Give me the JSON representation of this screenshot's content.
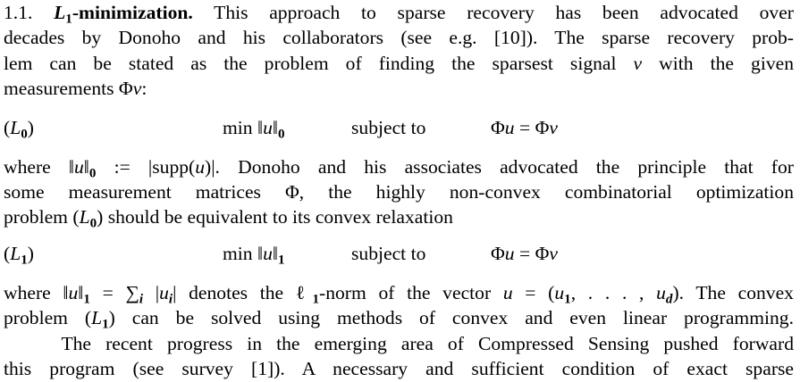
{
  "lines": [
    [
      {
        "t": "1.1. ",
        "s": "n"
      },
      {
        "t": "L",
        "s": "bi"
      },
      {
        "t": "1",
        "s": "bsub"
      },
      {
        "t": "-minimization.",
        "s": "b"
      },
      {
        "t": " This approach to sparse recovery has been advocated over",
        "s": "n"
      }
    ],
    [
      {
        "t": "decades by Donoho and his collaborators (see e.g. [10]). The sparse recovery prob-",
        "s": "n"
      }
    ],
    [
      {
        "t": "lem can be stated as the problem of finding the sparsest signal ",
        "s": "n"
      },
      {
        "t": "v",
        "s": "i"
      },
      {
        "t": " with the given",
        "s": "n"
      }
    ],
    [
      {
        "t": "measurements Φ",
        "s": "n"
      },
      {
        "t": "v",
        "s": "i"
      },
      {
        "t": ":",
        "s": "n"
      }
    ],
    [
      {
        "t": "where ‖",
        "s": "n"
      },
      {
        "t": "u",
        "s": "i"
      },
      {
        "t": "‖",
        "s": "n"
      },
      {
        "t": "0",
        "s": "sub"
      },
      {
        "t": " := |supp(",
        "s": "n"
      },
      {
        "t": "u",
        "s": "i"
      },
      {
        "t": ")|. Donoho and his associates advocated the principle that for",
        "s": "n"
      }
    ],
    [
      {
        "t": "some measurement matrices Φ, the highly non-convex combinatorial optimization",
        "s": "n"
      }
    ],
    [
      {
        "t": "problem (",
        "s": "n"
      },
      {
        "t": "L",
        "s": "i"
      },
      {
        "t": "0",
        "s": "sub"
      },
      {
        "t": ") should be equivalent to its convex relaxation",
        "s": "n"
      }
    ],
    [
      {
        "t": "where ‖",
        "s": "n"
      },
      {
        "t": "u",
        "s": "i"
      },
      {
        "t": "‖",
        "s": "n"
      },
      {
        "t": "1",
        "s": "sub"
      },
      {
        "t": " = ∑",
        "s": "n"
      },
      {
        "t": "i",
        "s": "isub"
      },
      {
        "t": " |",
        "s": "n"
      },
      {
        "t": "u",
        "s": "i"
      },
      {
        "t": "i",
        "s": "isub"
      },
      {
        "t": "| denotes the ℓ",
        "s": "n"
      },
      {
        "t": "1",
        "s": "sub"
      },
      {
        "t": "-norm of the vector ",
        "s": "n"
      },
      {
        "t": "u",
        "s": "i"
      },
      {
        "t": " = (",
        "s": "n"
      },
      {
        "t": "u",
        "s": "i"
      },
      {
        "t": "1",
        "s": "sub"
      },
      {
        "t": ", . . . , ",
        "s": "n"
      },
      {
        "t": "u",
        "s": "i"
      },
      {
        "t": "d",
        "s": "isub"
      },
      {
        "t": "). The convex",
        "s": "n"
      }
    ],
    [
      {
        "t": "problem (",
        "s": "n"
      },
      {
        "t": "L",
        "s": "i"
      },
      {
        "t": "1",
        "s": "sub"
      },
      {
        "t": ") can be solved using methods of convex and even linear programming.",
        "s": "n"
      }
    ],
    [
      {
        "t": "    The recent progress in the emerging area of Compressed Sensing pushed forward",
        "s": "n"
      }
    ],
    [
      {
        "t": "this program (see survey [1]). A necessary and sufficient condition of exact sparse",
        "s": "n"
      }
    ]
  ],
  "equations": [
    {
      "label": [
        {
          "t": "(",
          "s": "n"
        },
        {
          "t": "L",
          "s": "i"
        },
        {
          "t": "0",
          "s": "sub"
        },
        {
          "t": ")",
          "s": "n"
        }
      ],
      "objective": [
        {
          "t": "min ‖",
          "s": "n"
        },
        {
          "t": "u",
          "s": "i"
        },
        {
          "t": "‖",
          "s": "n"
        },
        {
          "t": "0",
          "s": "sub"
        }
      ],
      "subject": [
        {
          "t": "subject to",
          "s": "n"
        }
      ],
      "constraint": [
        {
          "t": "Φ",
          "s": "n"
        },
        {
          "t": "u",
          "s": "i"
        },
        {
          "t": " = Φ",
          "s": "n"
        },
        {
          "t": "v",
          "s": "i"
        }
      ]
    },
    {
      "label": [
        {
          "t": "(",
          "s": "n"
        },
        {
          "t": "L",
          "s": "i"
        },
        {
          "t": "1",
          "s": "sub"
        },
        {
          "t": ")",
          "s": "n"
        }
      ],
      "objective": [
        {
          "t": "min ‖",
          "s": "n"
        },
        {
          "t": "u",
          "s": "i"
        },
        {
          "t": "‖",
          "s": "n"
        },
        {
          "t": "1",
          "s": "sub"
        }
      ],
      "subject": [
        {
          "t": "subject to",
          "s": "n"
        }
      ],
      "constraint": [
        {
          "t": "Φ",
          "s": "n"
        },
        {
          "t": "u",
          "s": "i"
        },
        {
          "t": " = Φ",
          "s": "n"
        },
        {
          "t": "v",
          "s": "i"
        }
      ]
    }
  ]
}
